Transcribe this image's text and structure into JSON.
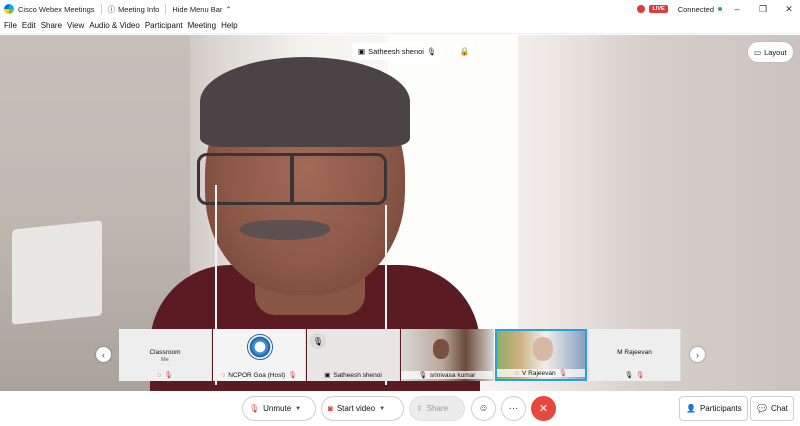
{
  "titlebar": {
    "app_title": "Cisco Webex Meetings",
    "meeting_info": "Meeting Info",
    "hide_menu_bar": "Hide Menu Bar",
    "live_badge": "LIVE",
    "status": "Connected"
  },
  "menu": [
    "File",
    "Edit",
    "Share",
    "View",
    "Audio & Video",
    "Participant",
    "Meeting",
    "Help"
  ],
  "stage": {
    "active_speaker": "Satheesh shenoi",
    "layout_label": "Layout"
  },
  "filmstrip": {
    "tiles": [
      {
        "name": "Classroom",
        "sub": "Me",
        "label": ""
      },
      {
        "name": "",
        "sub": "",
        "label": "NCPOR Goa  (Host)"
      },
      {
        "name": "",
        "sub": "",
        "label": "Satheesh shenoi"
      },
      {
        "name": "",
        "sub": "",
        "label": "srinivasa kumar"
      },
      {
        "name": "",
        "sub": "",
        "label": "V Rajeevan"
      },
      {
        "name": "M Rajeevan",
        "sub": "",
        "label": ""
      }
    ]
  },
  "toolbar": {
    "unmute": "Unmute",
    "start_video": "Start video",
    "share": "Share",
    "participants": "Participants",
    "chat": "Chat"
  },
  "colors": {
    "end_button": "#e5483d",
    "live_red": "#e03a3a",
    "connected_green": "#2fb54a",
    "active_tile_border": "#2aa0d8"
  }
}
